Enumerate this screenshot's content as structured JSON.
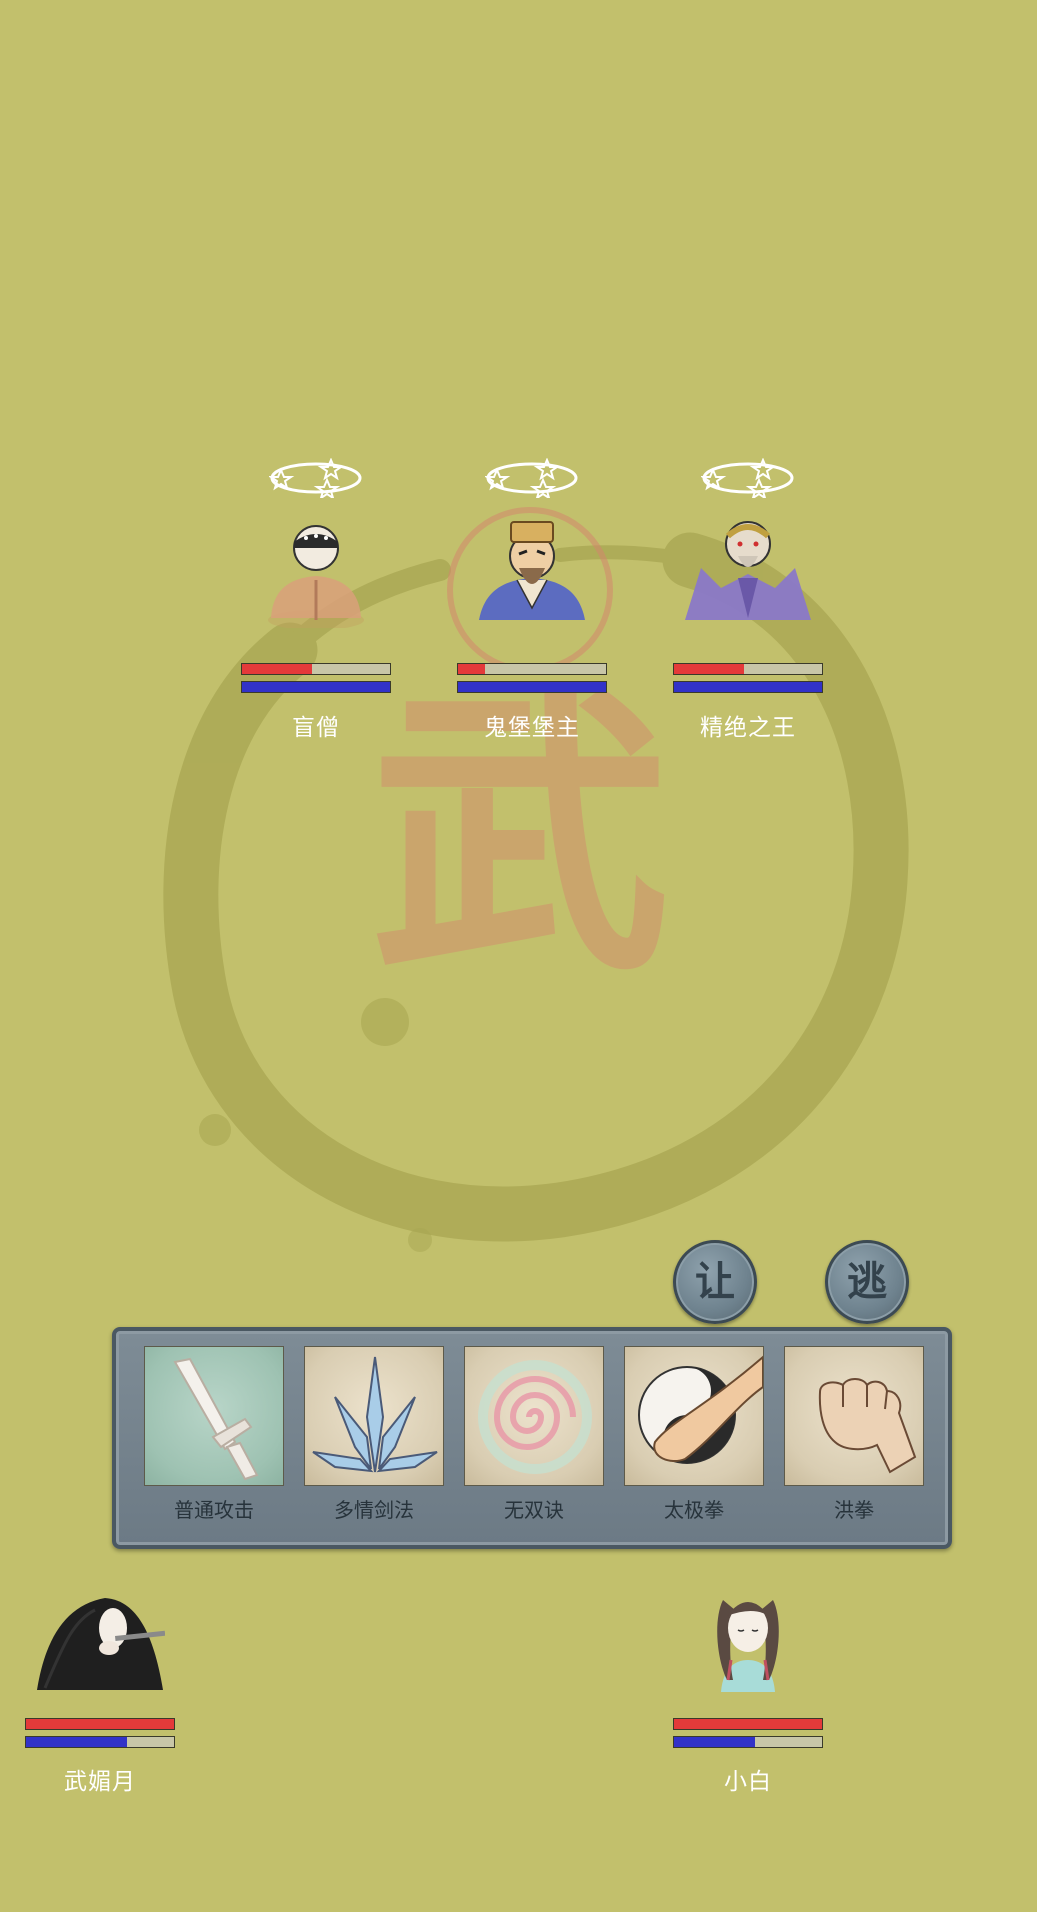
{
  "theme": {
    "background": "#c2c06c",
    "ink_ring": "#a4a44e",
    "seal_red": "#d4866e",
    "hp_color": "#e43a3a",
    "mp_color": "#3232c8",
    "panel_color": "#74828d"
  },
  "background": {
    "seal_character": "武"
  },
  "enemies": [
    {
      "name": "盲僧",
      "hp": 0.47,
      "mp": 1.0,
      "stunned": true,
      "portrait": "blind-monk-portrait"
    },
    {
      "name": "鬼堡堡主",
      "hp": 0.18,
      "mp": 1.0,
      "stunned": true,
      "portrait": "ghost-castle-lord-portrait"
    },
    {
      "name": "精绝之王",
      "hp": 0.47,
      "mp": 1.0,
      "stunned": true,
      "portrait": "jingjue-king-portrait"
    }
  ],
  "allies": [
    {
      "name": "武媚月",
      "hp": 1.0,
      "mp": 0.68,
      "portrait": "flute-player-portrait"
    },
    {
      "name": "小白",
      "hp": 1.0,
      "mp": 0.55,
      "portrait": "xiaobai-portrait"
    }
  ],
  "actions": {
    "yield_label": "让",
    "flee_label": "逃"
  },
  "skills": [
    {
      "label": "普通攻击",
      "icon": "sword-icon"
    },
    {
      "label": "多情剑法",
      "icon": "blades-icon"
    },
    {
      "label": "无双诀",
      "icon": "swirl-icon"
    },
    {
      "label": "太极拳",
      "icon": "taiji-icon"
    },
    {
      "label": "洪拳",
      "icon": "fist-icon"
    }
  ]
}
